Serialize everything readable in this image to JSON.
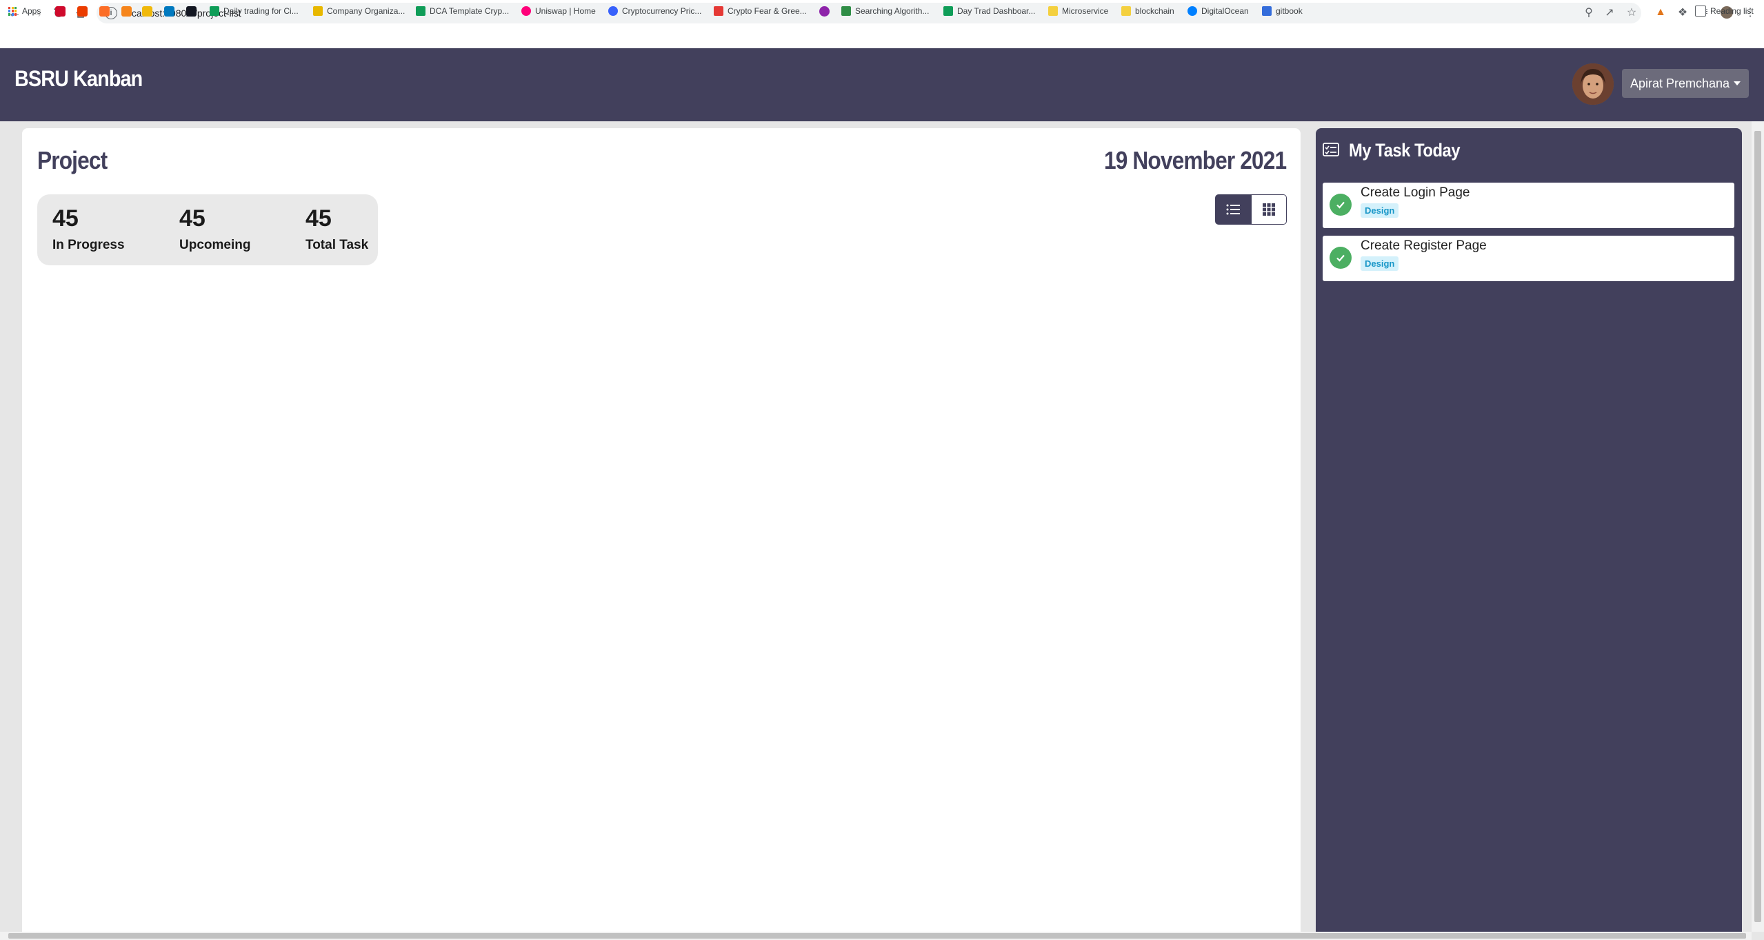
{
  "browser": {
    "url": "localhost:8080/#/project-list",
    "bookmarks": [
      {
        "label": "Apps",
        "color": "#ea4335"
      },
      {
        "label": "Daily trading for Ci...",
        "color": "#0f9d58"
      },
      {
        "label": "Company Organiza...",
        "color": "#e8b800"
      },
      {
        "label": "DCA Template Cryp...",
        "color": "#0f9d58"
      },
      {
        "label": "Uniswap | Home",
        "color": "#ff007a"
      },
      {
        "label": "Cryptocurrency Pric...",
        "color": "#3861fb"
      },
      {
        "label": "Crypto Fear & Gree...",
        "color": "#e53935"
      },
      {
        "label": "Searching Algorith...",
        "color": "#2f8d46"
      },
      {
        "label": "Day Trad Dashboar...",
        "color": "#0f9d58"
      },
      {
        "label": "Microservice",
        "color": "#f4d03f"
      },
      {
        "label": "blockchain",
        "color": "#f4d03f"
      },
      {
        "label": "DigitalOcean",
        "color": "#0080ff"
      },
      {
        "label": "gitbook",
        "color": "#346ddb"
      }
    ],
    "reading_list": "Reading list"
  },
  "navbar": {
    "brand": "BSRU Kanban",
    "user_name": "Apirat Premchana"
  },
  "project": {
    "title": "Project",
    "date": "19 November 2021",
    "stats": [
      {
        "value": "45",
        "label": "In Progress"
      },
      {
        "value": "45",
        "label": "Upcomeing"
      },
      {
        "value": "45",
        "label": "Total Task"
      }
    ]
  },
  "my_tasks": {
    "title": "My Task Today",
    "items": [
      {
        "name": "Create Login Page",
        "tag": "Design"
      },
      {
        "name": "Create Register Page",
        "tag": "Design"
      }
    ]
  },
  "colors": {
    "primary": "#42405c",
    "success": "#4caf62",
    "tag_bg": "#d4f1fb",
    "tag_text": "#1a97c8"
  }
}
